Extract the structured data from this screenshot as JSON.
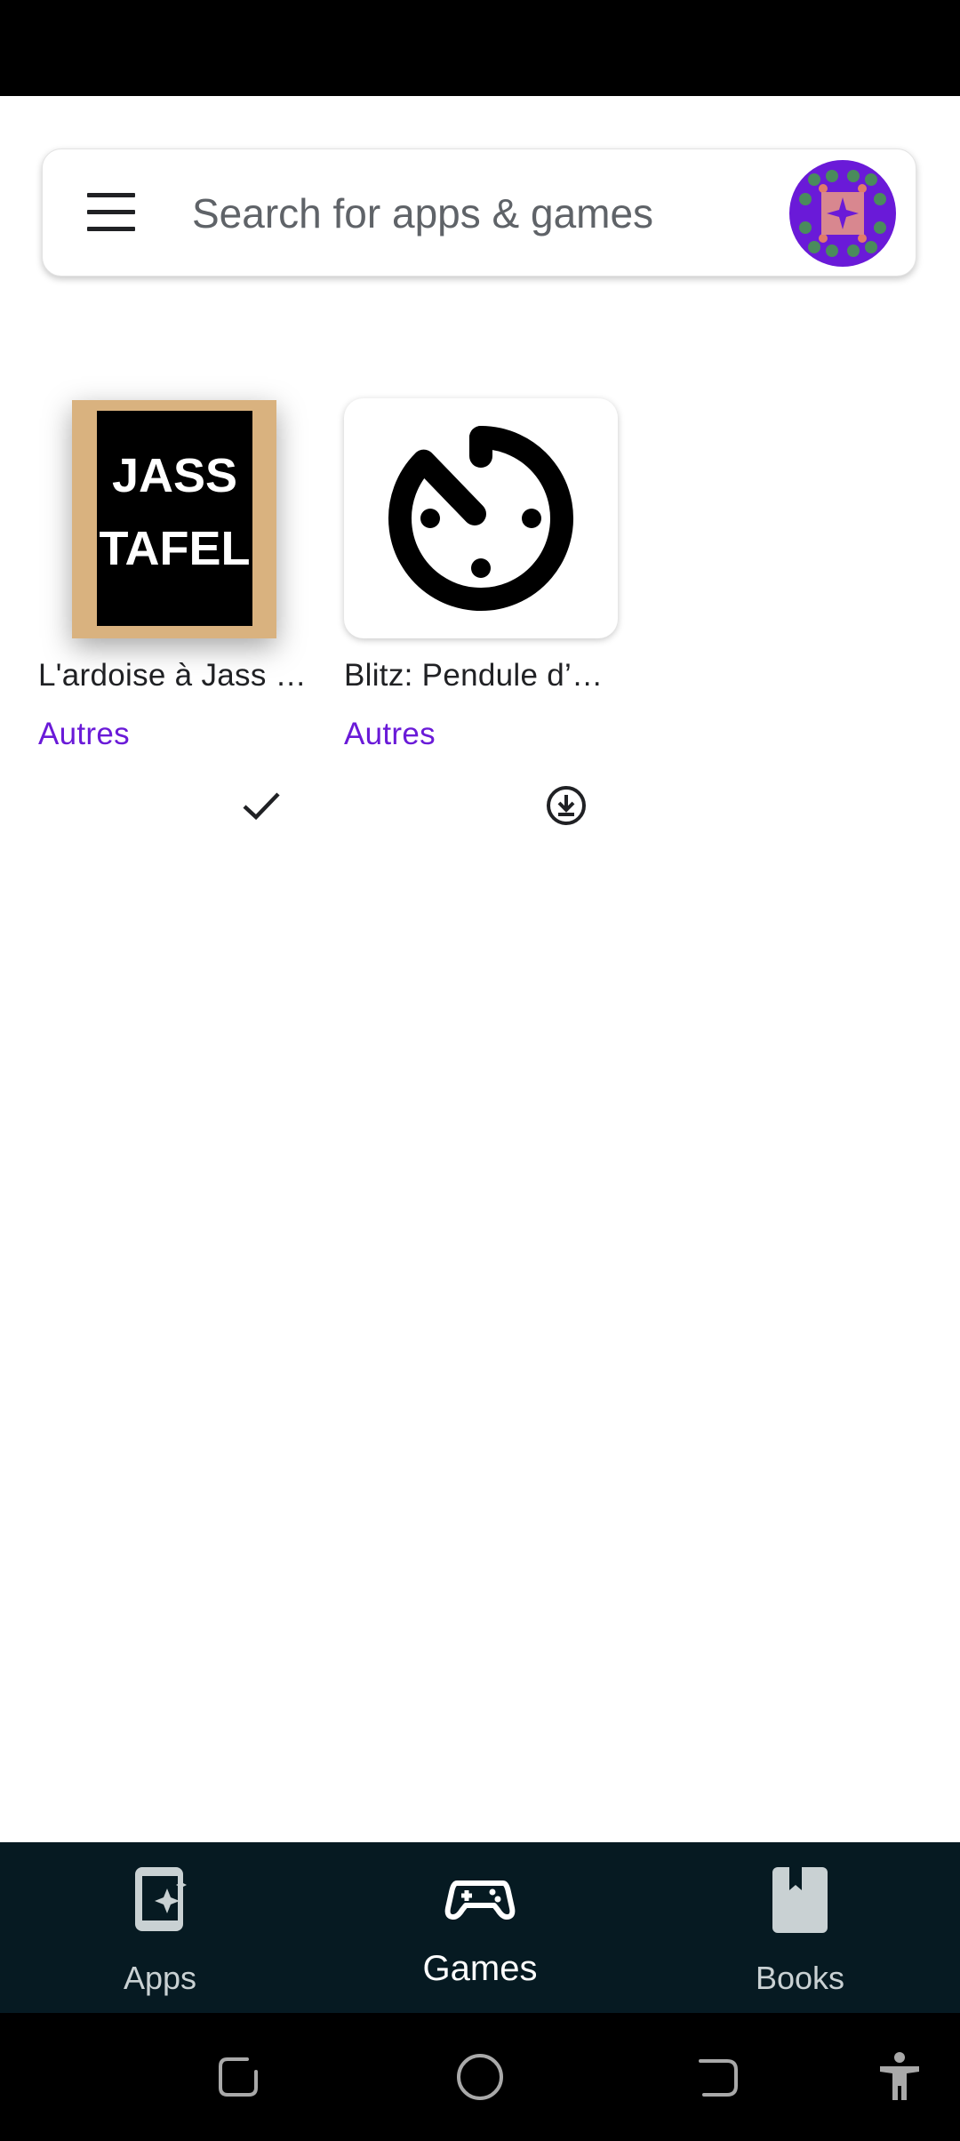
{
  "search": {
    "placeholder": "Search for apps & games"
  },
  "apps": [
    {
      "name": "L'ardoise à Jass …",
      "category": "Autres",
      "icon_lines": [
        "JASS",
        "TAFEL"
      ],
      "status_icon": "check-icon",
      "status": "installed"
    },
    {
      "name": "Blitz: Pendule d’…",
      "category": "Autres",
      "status_icon": "download-icon",
      "status": "available"
    }
  ],
  "bottom_nav": {
    "items": [
      {
        "label": "Apps",
        "icon": "apps-icon",
        "active": false
      },
      {
        "label": "Games",
        "icon": "gamepad-icon",
        "active": true
      },
      {
        "label": "Books",
        "icon": "book-icon",
        "active": false
      }
    ]
  },
  "colors": {
    "accent": "#6a1ad8",
    "nav_background": "#061a22",
    "status_bar": "#000000"
  }
}
